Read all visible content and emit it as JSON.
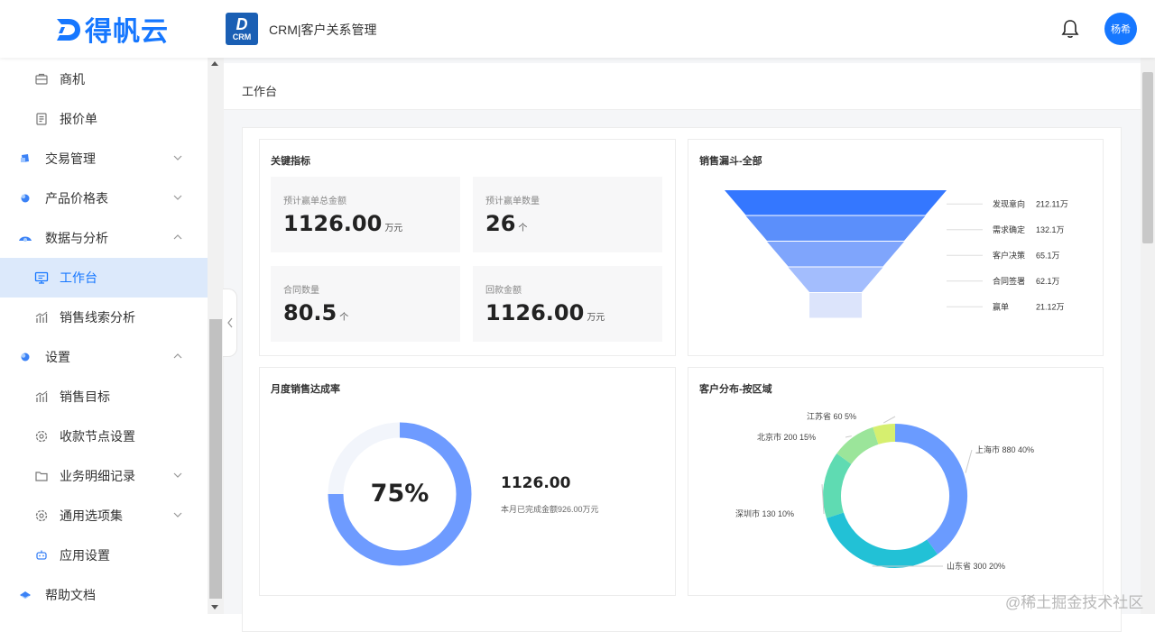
{
  "header": {
    "logo_text": "得帆云",
    "app_badge_letter": "D",
    "app_badge_text": "CRM",
    "app_title": "CRM|客户关系管理",
    "avatar_text": "杨希"
  },
  "sidebar": {
    "items": [
      {
        "label": "商机",
        "icon": "briefcase-icon"
      },
      {
        "label": "报价单",
        "icon": "quote-doc-icon"
      },
      {
        "label": "交易管理",
        "icon": "trade-icon",
        "expand": "down"
      },
      {
        "label": "产品价格表",
        "icon": "product-icon",
        "expand": "down"
      },
      {
        "label": "数据与分析",
        "icon": "data-icon",
        "expand": "up"
      },
      {
        "label": "工作台",
        "icon": "monitor-icon",
        "active": true
      },
      {
        "label": "销售线索分析",
        "icon": "bar-chart-icon"
      },
      {
        "label": "设置",
        "icon": "settings-icon",
        "expand": "up"
      },
      {
        "label": "销售目标",
        "icon": "bar-chart-icon"
      },
      {
        "label": "收款节点设置",
        "icon": "gear-icon"
      },
      {
        "label": "业务明细记录",
        "icon": "folder-icon",
        "expand": "down"
      },
      {
        "label": "通用选项集",
        "icon": "gear-icon",
        "expand": "down"
      },
      {
        "label": "应用设置",
        "icon": "robot-icon"
      },
      {
        "label": "帮助文档",
        "icon": "help-icon"
      }
    ]
  },
  "main": {
    "page_title": "工作台",
    "kpi_card": {
      "title": "关键指标",
      "items": [
        {
          "label": "预计赢单总金额",
          "value": "1126.00",
          "unit": "万元"
        },
        {
          "label": "预计赢单数量",
          "value": "26",
          "unit": "个"
        },
        {
          "label": "合同数量",
          "value": "80.5",
          "unit": "个"
        },
        {
          "label": "回款金额",
          "value": "1126.00",
          "unit": "万元"
        }
      ]
    },
    "funnel_card": {
      "title": "销售漏斗-全部"
    },
    "target_card": {
      "title": "月度销售达成率",
      "percent_text": "75%",
      "amount": "1126.00",
      "note": "本月已完成金额926.00万元"
    },
    "region_card": {
      "title": "客户分布-按区域"
    }
  },
  "colors": {
    "brand": "#1677ff",
    "funnel": [
      "#3477ff",
      "#5b8ffb",
      "#7fa5fc",
      "#a3bdfd",
      "#dce4fb"
    ],
    "pie": [
      "#6a9bff",
      "#22c1d6",
      "#5fdbb2",
      "#9be59a",
      "#d6ef6f"
    ]
  },
  "chart_data": [
    {
      "type": "funnel",
      "title": "销售漏斗-全部",
      "categories": [
        "发现意向",
        "需求确定",
        "客户决策",
        "合同签署",
        "赢单"
      ],
      "values": [
        212.11,
        132.1,
        65.1,
        62.1,
        21.12
      ],
      "value_labels": [
        "212.11万",
        "132.1万",
        "65.1万",
        "62.1万",
        "21.12万"
      ]
    },
    {
      "type": "pie",
      "title": "月度销售达成率",
      "values": [
        75,
        25
      ],
      "center_label": "75%"
    },
    {
      "type": "pie",
      "title": "客户分布-按区域",
      "slices": [
        {
          "name": "上海市",
          "value": 880,
          "percent": "40%"
        },
        {
          "name": "山东省",
          "value": 300,
          "percent": "20%"
        },
        {
          "name": "深圳市",
          "value": 130,
          "percent": "10%"
        },
        {
          "name": "北京市",
          "value": 200,
          "percent": "15%"
        },
        {
          "name": "江苏省",
          "value": 60,
          "percent": "5%"
        }
      ],
      "shares": [
        40,
        30,
        15,
        10,
        5
      ]
    }
  ],
  "watermark": "@稀土掘金技术社区"
}
